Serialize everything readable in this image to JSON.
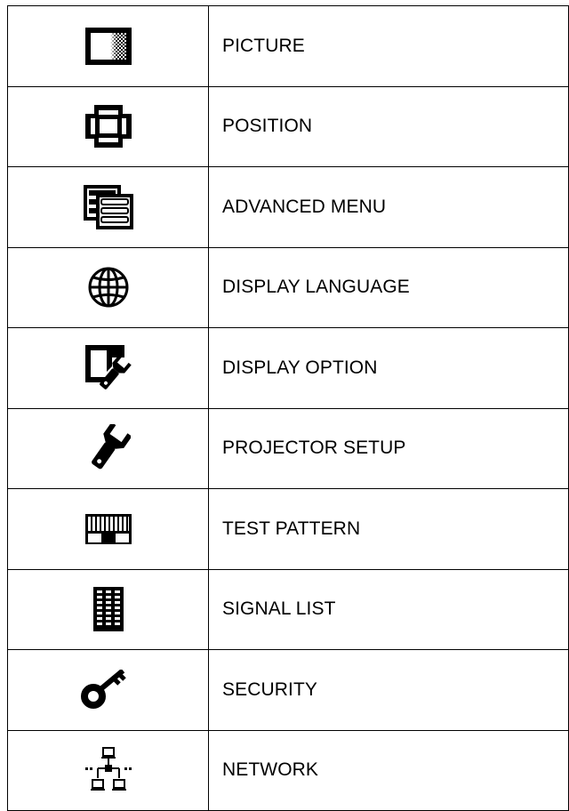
{
  "menu": {
    "items": [
      {
        "icon": "picture-icon",
        "label": "PICTURE"
      },
      {
        "icon": "position-icon",
        "label": "POSITION"
      },
      {
        "icon": "advanced-menu-icon",
        "label": "ADVANCED MENU"
      },
      {
        "icon": "globe-icon",
        "label": "DISPLAY LANGUAGE"
      },
      {
        "icon": "display-option-icon",
        "label": "DISPLAY OPTION"
      },
      {
        "icon": "wrench-hand-icon",
        "label": "PROJECTOR SETUP"
      },
      {
        "icon": "test-pattern-icon",
        "label": "TEST PATTERN"
      },
      {
        "icon": "signal-list-icon",
        "label": "SIGNAL LIST"
      },
      {
        "icon": "key-icon",
        "label": "SECURITY"
      },
      {
        "icon": "network-icon",
        "label": "NETWORK"
      }
    ]
  }
}
